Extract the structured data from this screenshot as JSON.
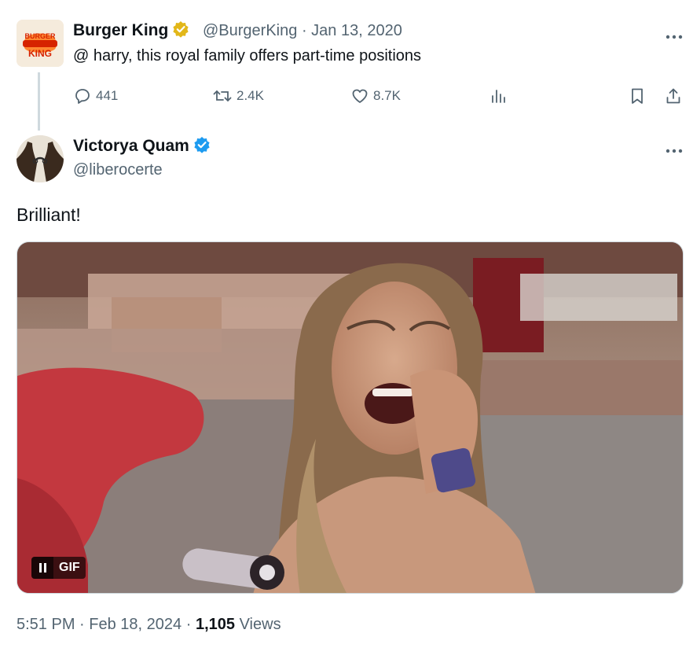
{
  "parent_tweet": {
    "display_name": "Burger King",
    "verified_badge": "gold-verified-badge-icon",
    "handle": "@BurgerKing",
    "date": "Jan 13, 2020",
    "text": "@ harry, this royal family offers part-time positions",
    "avatar_text_top": "BURGER",
    "avatar_text_bottom": "KING",
    "replies": "441",
    "reposts": "2.4K",
    "likes": "8.7K"
  },
  "reply_tweet": {
    "display_name": "Victorya Quam",
    "verified_badge": "blue-verified-badge-icon",
    "handle": "@liberocerte",
    "text": "Brilliant!",
    "media_type": "GIF",
    "gif_label": "GIF",
    "time": "5:51 PM",
    "date": "Feb 18, 2024",
    "views_count": "1,105",
    "views_label": "Views",
    "separator": "·"
  },
  "colors": {
    "text_primary": "#0f1419",
    "text_secondary": "#536471",
    "verified_blue": "#1d9bf0",
    "verified_gold": "#e2b719",
    "bk_orange": "#d62300"
  }
}
